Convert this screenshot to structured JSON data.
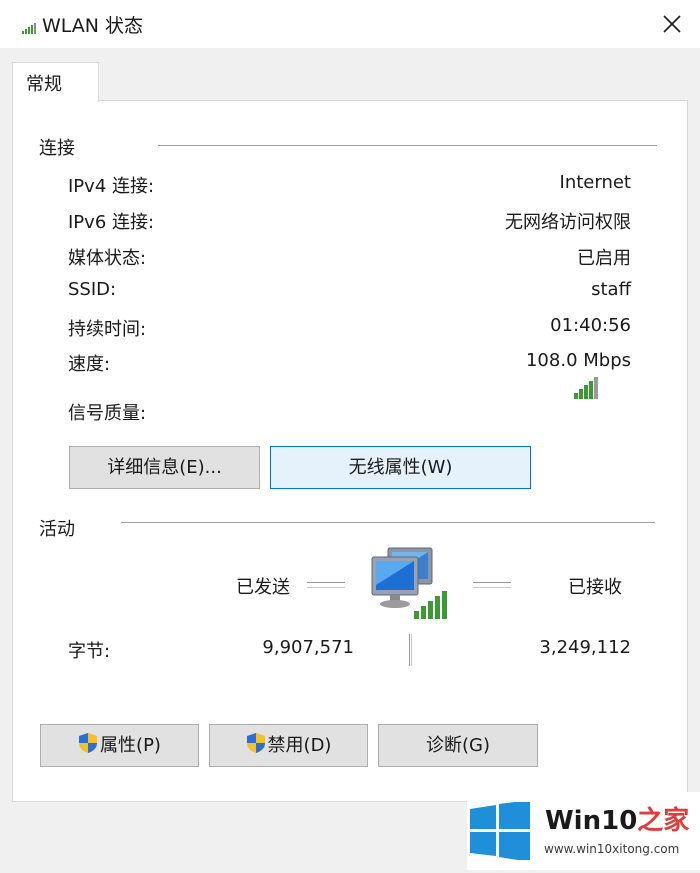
{
  "window": {
    "title": "WLAN 状态",
    "close_icon": "close-icon"
  },
  "tabs": [
    {
      "label": "常规"
    }
  ],
  "connection": {
    "section_title": "连接",
    "rows": [
      {
        "label": "IPv4 连接:",
        "value": "Internet"
      },
      {
        "label": "IPv6 连接:",
        "value": "无网络访问权限"
      },
      {
        "label": "媒体状态:",
        "value": "已启用"
      },
      {
        "label": "SSID:",
        "value": "staff"
      },
      {
        "label": "持续时间:",
        "value": "01:40:56"
      },
      {
        "label": "速度:",
        "value": "108.0 Mbps"
      }
    ],
    "signal": {
      "label": "信号质量:",
      "bars_total": 5,
      "bars_filled": 4
    },
    "buttons": {
      "details": "详细信息(E)...",
      "wireless_properties": "无线属性(W)"
    }
  },
  "activity": {
    "section_title": "活动",
    "sent_label": "已发送",
    "received_label": "已接收",
    "bytes_label": "字节:",
    "bytes_sent": "9,907,571",
    "bytes_received": "3,249,112"
  },
  "footer_buttons": {
    "properties": "属性(P)",
    "disable": "禁用(D)",
    "diagnose": "诊断(G)"
  },
  "watermark": {
    "title_part1": "Win10",
    "title_part2": "之家",
    "url": "www.win10xitong.com"
  },
  "colors": {
    "accent": "#0078d7",
    "signal_green": "#3c9a35",
    "watermark_blue": "#1e8fd8",
    "watermark_red": "#e23b3b"
  }
}
